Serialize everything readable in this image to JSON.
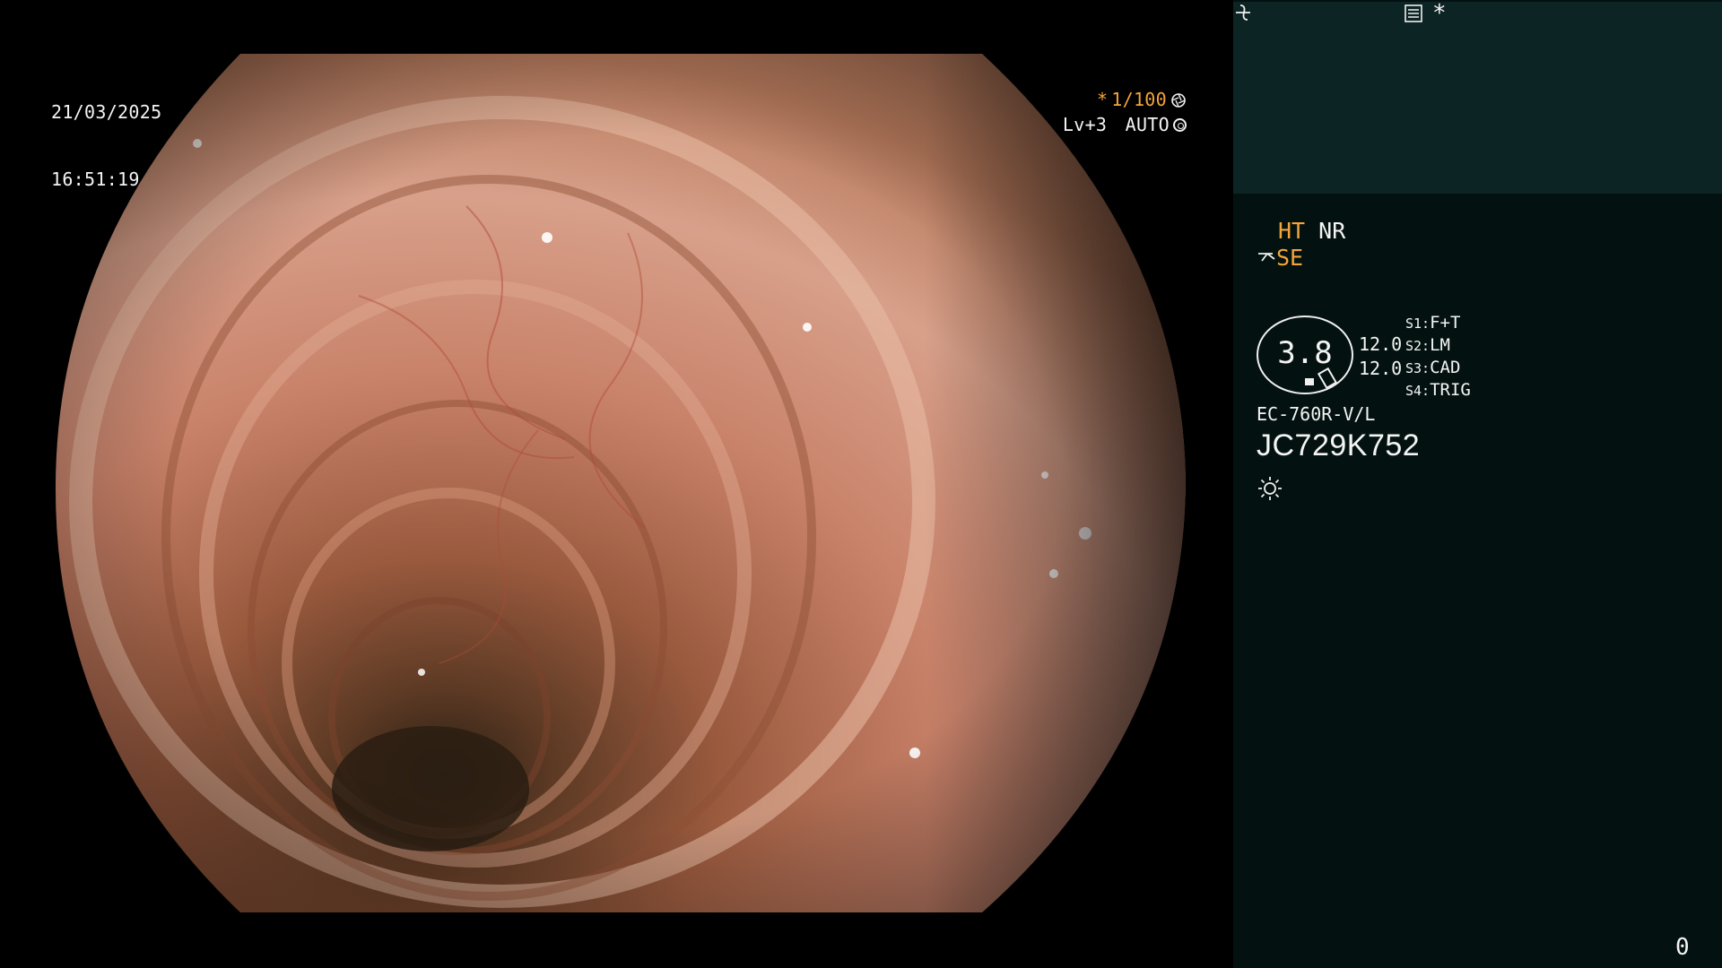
{
  "overlay": {
    "date": "21/03/2025",
    "time": "16:51:19",
    "shutter_prefix": "*",
    "shutter": "1/100",
    "level": "Lv+3",
    "exposure_mode": "AUTO"
  },
  "panel": {
    "mode_ht": "HT",
    "mode_nr": "NR",
    "mode_se": "SE",
    "star_marker": "*",
    "scope_value": "3.8",
    "zoom_top": "12.0",
    "zoom_bottom": "12.0",
    "switches": [
      {
        "key": "S1:",
        "value": "F+T"
      },
      {
        "key": "S2:",
        "value": "LM"
      },
      {
        "key": "S3:",
        "value": "CAD"
      },
      {
        "key": "S4:",
        "value": "TRIG"
      }
    ],
    "scope_model": "EC-760R-V/L",
    "scope_serial": "JC729K752",
    "frame_counter": "0"
  },
  "colors": {
    "accent": "#f3a43a",
    "panel_bg": "#031210",
    "thumb_bg": "#0d2424",
    "text": "#f4f4f4"
  },
  "icons": [
    "aperture-icon",
    "iris-icon",
    "scissors-icon",
    "enhance-icon",
    "memo-icon",
    "light-icon"
  ]
}
